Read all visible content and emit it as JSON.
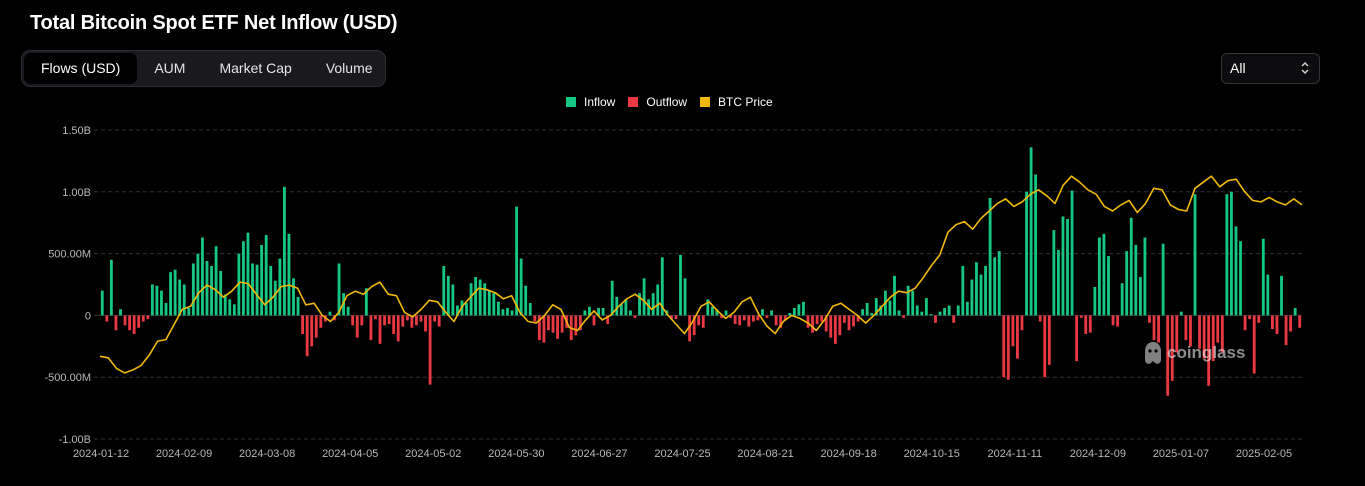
{
  "title": "Total Bitcoin Spot ETF Net Inflow (USD)",
  "tabs": [
    {
      "label": "Flows (USD)",
      "active": true
    },
    {
      "label": "AUM",
      "active": false
    },
    {
      "label": "Market Cap",
      "active": false
    },
    {
      "label": "Volume",
      "active": false
    }
  ],
  "range_select": {
    "value": "All"
  },
  "watermark": "coinglass",
  "colors": {
    "inflow": "#16c784",
    "outflow": "#ea3943",
    "btc_price": "#f0b90b",
    "grid": "#2f2f35",
    "axis_text": "#b8b8b8"
  },
  "chart_data": {
    "type": "bar",
    "title": "Total Bitcoin Spot ETF Net Inflow (USD)",
    "legend": [
      {
        "name": "Inflow",
        "color": "#16c784"
      },
      {
        "name": "Outflow",
        "color": "#ea3943"
      },
      {
        "name": "BTC Price",
        "color": "#f0b90b"
      }
    ],
    "legend_position": "top-center",
    "grid": true,
    "y_axis": {
      "min": -1000000000,
      "max": 1500000000,
      "ticks": [
        {
          "value": 1500000000,
          "label": "1.50B"
        },
        {
          "value": 1000000000,
          "label": "1.00B"
        },
        {
          "value": 500000000,
          "label": "500.00M"
        },
        {
          "value": 0,
          "label": "0"
        },
        {
          "value": -500000000,
          "label": "-500.00M"
        },
        {
          "value": -1000000000,
          "label": "-1.00B"
        }
      ]
    },
    "x_ticks": [
      "2024-01-12",
      "2024-02-09",
      "2024-03-08",
      "2024-04-05",
      "2024-05-02",
      "2024-05-30",
      "2024-06-27",
      "2024-07-25",
      "2024-08-21",
      "2024-09-18",
      "2024-10-15",
      "2024-11-11",
      "2024-12-09",
      "2025-01-07",
      "2025-02-05"
    ],
    "flows_millions": [
      200,
      -50,
      450,
      -120,
      50,
      -80,
      -120,
      -150,
      -100,
      -50,
      -30,
      250,
      240,
      200,
      100,
      350,
      370,
      290,
      250,
      60,
      420,
      500,
      630,
      440,
      400,
      560,
      360,
      170,
      130,
      90,
      500,
      600,
      670,
      420,
      410,
      570,
      650,
      400,
      280,
      460,
      1040,
      660,
      300,
      150,
      -150,
      -330,
      -250,
      -180,
      -100,
      -50,
      30,
      -40,
      420,
      180,
      70,
      -80,
      -180,
      -80,
      220,
      -200,
      -30,
      -230,
      -80,
      -70,
      -150,
      -210,
      -90,
      -40,
      -100,
      -80,
      -50,
      -130,
      -560,
      -50,
      -90,
      400,
      320,
      250,
      80,
      120,
      100,
      260,
      310,
      290,
      260,
      200,
      180,
      110,
      50,
      60,
      40,
      880,
      460,
      240,
      100,
      -50,
      -200,
      -220,
      -120,
      -140,
      -190,
      -140,
      -100,
      -200,
      -160,
      -120,
      40,
      70,
      -80,
      60,
      60,
      -70,
      280,
      150,
      90,
      130,
      40,
      -20,
      180,
      300,
      130,
      180,
      250,
      470,
      40,
      -30,
      -30,
      490,
      300,
      -210,
      -160,
      -80,
      -100,
      130,
      70,
      50,
      -20,
      40,
      -20,
      -70,
      -80,
      -40,
      -90,
      -50,
      -40,
      50,
      -20,
      40,
      -80,
      -100,
      -40,
      20,
      60,
      90,
      110,
      -100,
      -140,
      -70,
      -50,
      -130,
      -180,
      -230,
      -160,
      -60,
      -120,
      -90,
      -50,
      50,
      100,
      20,
      140,
      80,
      200,
      120,
      320,
      40,
      -20,
      240,
      200,
      80,
      30,
      140,
      10,
      -60,
      30,
      60,
      80,
      -60,
      80,
      400,
      110,
      290,
      430,
      330,
      400,
      950,
      470,
      520,
      -500,
      -520,
      -250,
      -350,
      -120,
      1000,
      1360,
      1140,
      -50,
      -500,
      -400,
      690,
      530,
      800,
      780,
      1010,
      -370,
      -20,
      -150,
      -140,
      230,
      630,
      660,
      480,
      -80,
      -90,
      260,
      520,
      790,
      570,
      310,
      630,
      -60,
      -200,
      -220,
      580,
      -650,
      -530,
      -300,
      30,
      -200,
      -250,
      980,
      -270,
      -350,
      -570,
      -370,
      -220,
      -300,
      980,
      1000,
      720,
      600,
      -120,
      -30,
      -470,
      -60,
      620,
      330,
      -110,
      -150,
      320,
      -240,
      -130,
      60,
      -100
    ],
    "btc_price_usd": [
      46500,
      46000,
      42500,
      41000,
      42000,
      43500,
      47000,
      51500,
      52000,
      57000,
      62000,
      63000,
      67500,
      70000,
      68500,
      66000,
      68000,
      71000,
      70500,
      67000,
      63500,
      66000,
      69500,
      70000,
      69000,
      63500,
      64000,
      60000,
      58000,
      61000,
      66500,
      68000,
      67000,
      69500,
      71000,
      67000,
      66500,
      61000,
      59500,
      62000,
      65000,
      64500,
      61000,
      58000,
      63000,
      66000,
      69000,
      68500,
      67500,
      65500,
      66500,
      61000,
      58000,
      57500,
      60000,
      63500,
      62000,
      56000,
      55000,
      58500,
      61500,
      58500,
      60000,
      63000,
      65500,
      67000,
      65000,
      62000,
      64000,
      60000,
      57000,
      54000,
      58000,
      63000,
      64500,
      61500,
      59000,
      61000,
      64500,
      66000,
      60500,
      56500,
      54000,
      58000,
      60000,
      59000,
      57500,
      55000,
      58500,
      63000,
      64000,
      62000,
      60000,
      57500,
      60000,
      63000,
      66000,
      68000,
      67500,
      69000,
      72500,
      76500,
      80000,
      87500,
      90000,
      91000,
      88500,
      92000,
      94500,
      97000,
      98500,
      96000,
      97500,
      100000,
      101500,
      99500,
      97000,
      103000,
      106000,
      104000,
      101500,
      100000,
      96000,
      94500,
      96500,
      98000,
      94000,
      97000,
      102000,
      101500,
      96500,
      95000,
      94500,
      102000,
      104000,
      106000,
      102500,
      104500,
      105000,
      101000,
      98000,
      97500,
      99000,
      97500,
      96500,
      98500,
      96500
    ]
  }
}
